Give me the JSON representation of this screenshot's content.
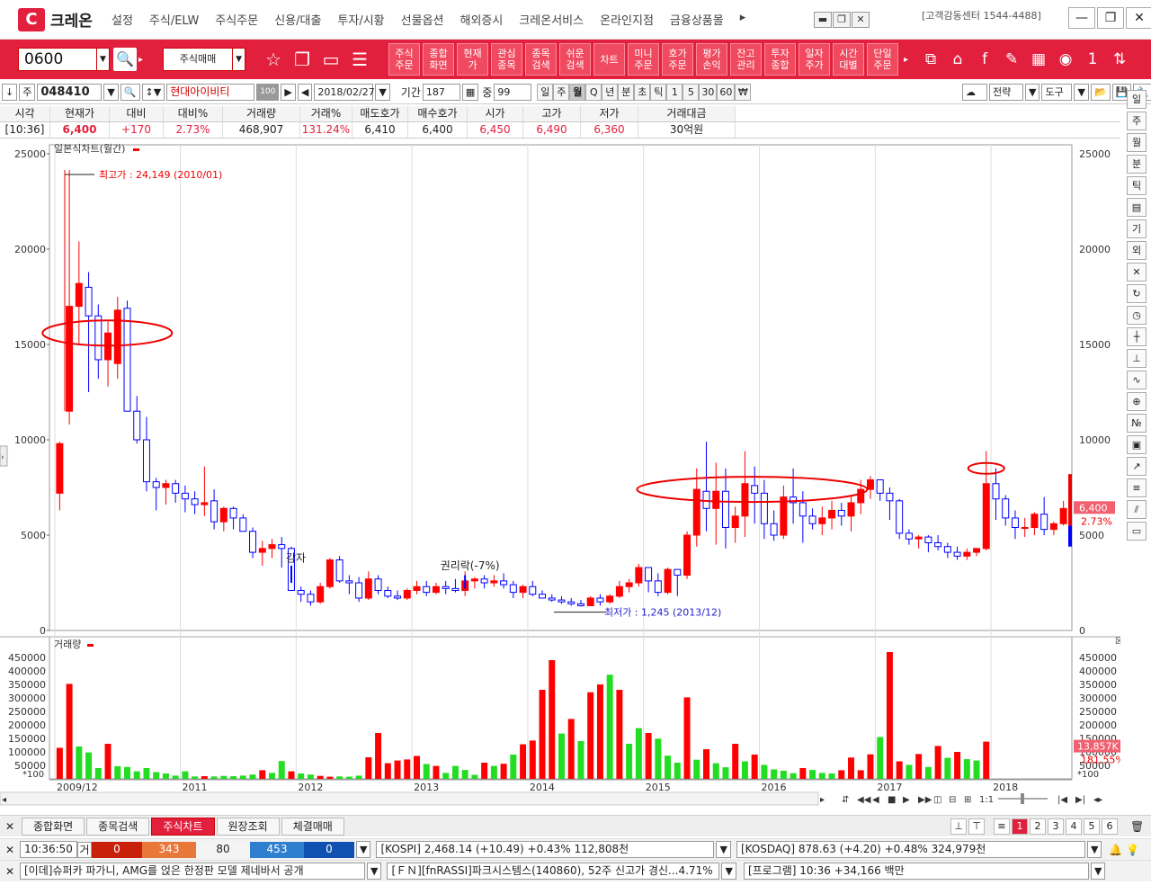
{
  "app": {
    "logo_letter": "C",
    "logo_text": "크레온",
    "customer_center": "[고객감동센터 1544-4488]"
  },
  "menu": [
    "설정",
    "주식/ELW",
    "주식주문",
    "신용/대출",
    "투자/시황",
    "선물옵션",
    "해외증시",
    "크레온서비스",
    "온라인지점",
    "금융상품몰",
    "▸"
  ],
  "toolbar": {
    "screen_code": "0600",
    "trade_select": "주식매매",
    "buttons": [
      "주식\n주문",
      "종합\n화면",
      "현재\n가",
      "관심\n종목",
      "종목\n검색",
      "쉬운\n검색",
      "차트",
      "미니\n주문",
      "호가\n주문",
      "평가\n손익",
      "잔고\n관리",
      "투자\n종합",
      "일자\n주가",
      "시간\n대별",
      "단일\n주문"
    ]
  },
  "secbar": {
    "prefix": "주",
    "code": "048410",
    "name": "현대아이비티",
    "name_badge": "100",
    "date": "2018/02/27",
    "period_label": "기간",
    "period": "187",
    "overlap_label": "중",
    "overlap": "99",
    "periods": [
      "일",
      "주",
      "월",
      "Q",
      "년",
      "분",
      "초",
      "틱",
      "1",
      "5",
      "30",
      "60",
      "₩"
    ],
    "active_period": "월",
    "right_buttons": [
      "전략",
      "도구"
    ]
  },
  "quote": {
    "headers": [
      "시각",
      "현재가",
      "대비",
      "대비%",
      "거래량",
      "거래%",
      "매도호가",
      "매수호가",
      "시가",
      "고가",
      "저가",
      "거래대금"
    ],
    "values": [
      "[10:36]",
      "6,400",
      "+170",
      "2.73%",
      "468,907",
      "131.24%",
      "6,410",
      "6,400",
      "6,450",
      "6,490",
      "6,360",
      "30억원"
    ]
  },
  "chart": {
    "price_title": "일본식차트(월간)",
    "volume_title": "거래량",
    "price_ticks": [
      "25000",
      "20000",
      "15000",
      "10000",
      "5000",
      "0"
    ],
    "volume_ticks": [
      "450000",
      "400000",
      "350000",
      "300000",
      "250000",
      "200000",
      "150000",
      "100000",
      "50000"
    ],
    "volume_unit": "*100",
    "x_labels": [
      "2009/12",
      "2011",
      "2012",
      "2013",
      "2014",
      "2015",
      "2016",
      "2017",
      "2018"
    ],
    "high_note": "최고가 : 24,149 (2010/01)",
    "low_note": "최저가 : 1,245 (2013/12)",
    "annot_reduction": "감자",
    "annot_rights": "권리락(-7%)",
    "last_price": "6,400",
    "last_pct": "2.73%",
    "vol_value": "13,857K",
    "vol_pct": "181.55%",
    "colors": {
      "up": "#ff0000",
      "down": "#0000ff",
      "vol_up": "#ff0000",
      "vol_down": "#22dd22"
    }
  },
  "chart_data": {
    "type": "candlestick",
    "title": "일본식차트(월간)",
    "y_range": [
      0,
      25000
    ],
    "candles_ohlc": [
      [
        7200,
        9900,
        6300,
        9800
      ],
      [
        11500,
        24149,
        10800,
        17000
      ],
      [
        17000,
        20400,
        15000,
        18200
      ],
      [
        18000,
        18800,
        12500,
        16500
      ],
      [
        16500,
        17100,
        13200,
        14200
      ],
      [
        14200,
        16200,
        12800,
        15600
      ],
      [
        14000,
        17500,
        13200,
        16800
      ],
      [
        16900,
        17300,
        11800,
        11500
      ],
      [
        11500,
        12300,
        9800,
        10000
      ],
      [
        10000,
        11200,
        7300,
        7800
      ],
      [
        7800,
        8000,
        6300,
        7500
      ],
      [
        7500,
        7900,
        6600,
        7700
      ],
      [
        7700,
        7900,
        6700,
        7200
      ],
      [
        7200,
        7600,
        6200,
        6900
      ],
      [
        6900,
        7300,
        6100,
        6600
      ],
      [
        6600,
        8600,
        6000,
        6700
      ],
      [
        6800,
        7400,
        5300,
        5700
      ],
      [
        5700,
        6500,
        5200,
        6400
      ],
      [
        6400,
        6500,
        5300,
        5900
      ],
      [
        5900,
        6100,
        5200,
        5200
      ],
      [
        5200,
        5400,
        3800,
        4100
      ],
      [
        4100,
        4700,
        3400,
        4300
      ],
      [
        4300,
        4800,
        3800,
        4500
      ],
      [
        4500,
        4900,
        3300,
        4300
      ],
      [
        4300,
        4400,
        2200,
        2100
      ],
      [
        2100,
        2300,
        1500,
        1900
      ],
      [
        1900,
        2100,
        1300,
        1500
      ],
      [
        1500,
        2500,
        1400,
        2300
      ],
      [
        2300,
        3800,
        2200,
        3700
      ],
      [
        3700,
        3900,
        2500,
        2600
      ],
      [
        2600,
        2900,
        1900,
        2500
      ],
      [
        2500,
        2800,
        1500,
        1700
      ],
      [
        1700,
        3100,
        1600,
        2700
      ],
      [
        2700,
        2900,
        1900,
        2100
      ],
      [
        2100,
        2300,
        1700,
        1800
      ],
      [
        1800,
        2100,
        1600,
        1700
      ],
      [
        1700,
        2200,
        1600,
        2100
      ],
      [
        2100,
        2600,
        1900,
        2300
      ],
      [
        2300,
        2600,
        1800,
        2000
      ],
      [
        2000,
        2500,
        1900,
        2300
      ],
      [
        2300,
        2600,
        1900,
        2200
      ],
      [
        2200,
        2700,
        2000,
        2100
      ],
      [
        2100,
        3100,
        1800,
        2600
      ],
      [
        2600,
        2800,
        2200,
        2700
      ],
      [
        2700,
        2900,
        2200,
        2500
      ],
      [
        2500,
        2900,
        2300,
        2600
      ],
      [
        2600,
        3000,
        2200,
        2400
      ],
      [
        2400,
        2600,
        1700,
        2000
      ],
      [
        2000,
        2400,
        1700,
        2300
      ],
      [
        2300,
        2600,
        1800,
        1900
      ],
      [
        1900,
        2100,
        1700,
        1700
      ],
      [
        1700,
        1900,
        1500,
        1600
      ],
      [
        1600,
        1800,
        1400,
        1500
      ],
      [
        1500,
        1700,
        1300,
        1400
      ],
      [
        1400,
        1600,
        1245,
        1300
      ],
      [
        1300,
        1800,
        1300,
        1700
      ],
      [
        1700,
        1900,
        1300,
        1500
      ],
      [
        1500,
        1900,
        1400,
        1800
      ],
      [
        1800,
        2600,
        1700,
        2300
      ],
      [
        2300,
        2700,
        2000,
        2500
      ],
      [
        2500,
        3500,
        2300,
        3300
      ],
      [
        3300,
        3200,
        2000,
        2600
      ],
      [
        2600,
        3000,
        1800,
        2000
      ],
      [
        2000,
        3300,
        1900,
        3200
      ],
      [
        3200,
        3200,
        1800,
        2900
      ],
      [
        2900,
        5200,
        2700,
        5000
      ],
      [
        5000,
        8500,
        4400,
        7400
      ],
      [
        7300,
        9900,
        5200,
        6400
      ],
      [
        6400,
        8800,
        4500,
        7300
      ],
      [
        7300,
        8500,
        4300,
        5400
      ],
      [
        5400,
        6500,
        4600,
        6000
      ],
      [
        6000,
        9400,
        4900,
        7700
      ],
      [
        7600,
        8600,
        5600,
        7200
      ],
      [
        7200,
        7900,
        4800,
        5600
      ],
      [
        5600,
        6300,
        4700,
        5000
      ],
      [
        5000,
        7600,
        4800,
        7000
      ],
      [
        7000,
        8500,
        5600,
        6700
      ],
      [
        6700,
        7300,
        4600,
        6000
      ],
      [
        6000,
        6400,
        5300,
        5600
      ],
      [
        5600,
        6500,
        5000,
        5900
      ],
      [
        5900,
        6800,
        5300,
        6300
      ],
      [
        6300,
        6700,
        5500,
        6000
      ],
      [
        6000,
        7100,
        5200,
        6700
      ],
      [
        6700,
        7900,
        6100,
        7400
      ],
      [
        7400,
        8100,
        6900,
        7900
      ],
      [
        7900,
        7900,
        6800,
        7200
      ],
      [
        7200,
        7500,
        5800,
        6800
      ],
      [
        6800,
        6900,
        4800,
        5100
      ],
      [
        5100,
        5300,
        4500,
        4800
      ],
      [
        4800,
        5000,
        4300,
        4900
      ],
      [
        4900,
        5000,
        4100,
        4600
      ],
      [
        4600,
        5000,
        4200,
        4400
      ],
      [
        4400,
        4600,
        3800,
        4100
      ],
      [
        4100,
        4400,
        3700,
        3900
      ],
      [
        3900,
        4300,
        3700,
        4100
      ],
      [
        4100,
        4200,
        3900,
        4300
      ],
      [
        4300,
        9400,
        4200,
        7700
      ],
      [
        7700,
        8500,
        5800,
        6900
      ],
      [
        6900,
        7100,
        5500,
        5900
      ],
      [
        5900,
        6300,
        4800,
        5400
      ],
      [
        5400,
        5900,
        4900,
        5400
      ],
      [
        5400,
        6200,
        5000,
        6100
      ],
      [
        6100,
        7000,
        5000,
        5300
      ],
      [
        5300,
        5700,
        5000,
        5600
      ],
      [
        5600,
        6800,
        5500,
        6400
      ]
    ],
    "volume": [
      115000,
      352000,
      120000,
      98000,
      40000,
      130000,
      47000,
      44000,
      28000,
      40000,
      25000,
      20000,
      12000,
      28000,
      9000,
      10000,
      9000,
      11000,
      10000,
      12000,
      16000,
      32000,
      22000,
      66000,
      28000,
      20000,
      16000,
      11000,
      8000,
      9000,
      8000,
      12000,
      80000,
      170000,
      58000,
      68000,
      72000,
      85000,
      55000,
      48000,
      22000,
      48000,
      33000,
      15000,
      60000,
      48000,
      56000,
      90000,
      128000,
      142000,
      330000,
      440000,
      168000,
      222000,
      140000,
      321000,
      350000,
      386000,
      330000,
      130000,
      188000,
      170000,
      149000,
      86000,
      60000,
      302000,
      71000,
      110000,
      58000,
      43000,
      130000,
      65000,
      90000,
      52000,
      35000,
      30000,
      21000,
      40000,
      33000,
      22000,
      20000,
      32000,
      79000,
      32000,
      91000,
      155000,
      470000,
      65000,
      52000,
      92000,
      44000,
      122000,
      78000,
      100000,
      73000,
      68000,
      138000
    ],
    "volume_up_flags": [
      1,
      1,
      0,
      0,
      0,
      1,
      0,
      0,
      0,
      0,
      0,
      0,
      0,
      0,
      0,
      1,
      0,
      0,
      0,
      0,
      0,
      1,
      0,
      0,
      1,
      0,
      0,
      1,
      1,
      0,
      0,
      0,
      1,
      1,
      1,
      1,
      1,
      1,
      0,
      1,
      0,
      0,
      0,
      0,
      1,
      0,
      1,
      0,
      1,
      1,
      1,
      1,
      0,
      1,
      0,
      1,
      1,
      0,
      1,
      0,
      0,
      1,
      0,
      0,
      0,
      1,
      0,
      1,
      0,
      0,
      1,
      0,
      1,
      0,
      0,
      0,
      0,
      1,
      0,
      0,
      0,
      1,
      1,
      1,
      1,
      0,
      1,
      1,
      0,
      1,
      0,
      1,
      0,
      1,
      0,
      0,
      1
    ],
    "x_labels": [
      "2009/12",
      "2011",
      "2012",
      "2013",
      "2014",
      "2015",
      "2016",
      "2017",
      "2018"
    ]
  },
  "bottom": {
    "tabs": [
      "종합화면",
      "종목검색",
      "주식차트",
      "원장조회",
      "체결매매"
    ],
    "active_tab": "주식차트",
    "nums": [
      "1",
      "2",
      "3",
      "4",
      "5",
      "6"
    ],
    "time": "10:36:50",
    "stat_label": "거",
    "stats": [
      "0",
      "343",
      "80",
      "453",
      "0"
    ],
    "kospi": "[KOSPI] 2,468.14 (+10.49) +0.43% 112,808천",
    "kosdaq": "[KOSDAQ] 878.63 (+4.20) +0.48% 324,979천",
    "news1": "[이데]슈퍼카 파가니, AMG를 얹은 한정판 모델 제네바서 공개",
    "news2": "[ＦＮ][fnRASSI]파크시스템스(140860), 52주 신고가 경신...4.71%",
    "program": "[프로그램] 10:36 +34,166 백만"
  }
}
